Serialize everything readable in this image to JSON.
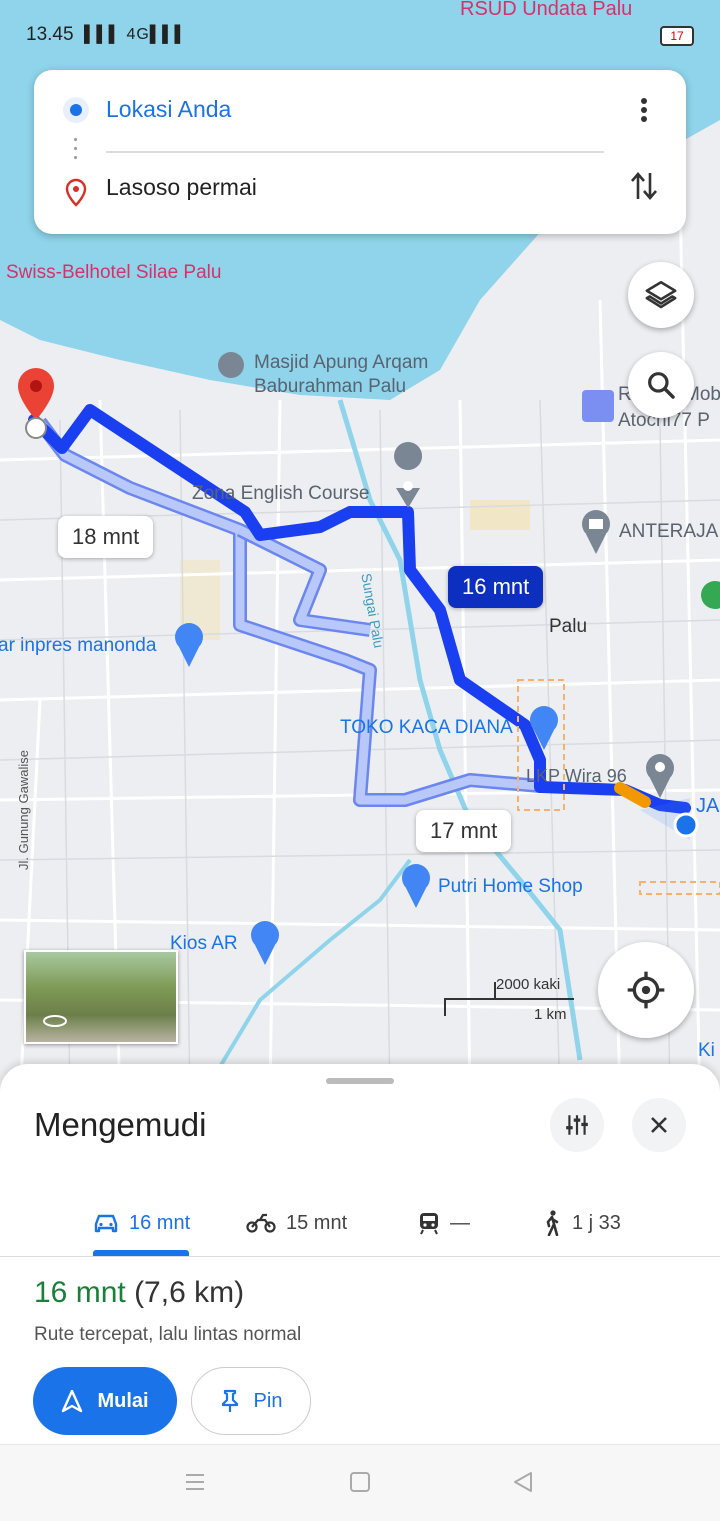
{
  "status_bar": {
    "time": "13.45",
    "signal": "▌▌▌ 4G▌▌▌",
    "battery": "17"
  },
  "directions": {
    "origin": "Lokasi Anda",
    "destination": "Lasoso permai"
  },
  "map_labels": {
    "hospital": "RSUD Undata Palu",
    "hotel": "Swiss-Belhotel Silae Palu",
    "mosque_line1": "Masjid Apung Arqam",
    "mosque_line2": "Baburahman Palu",
    "dealer_line1": "R",
    "dealer_line1b": "Mob",
    "dealer_line2": "Atocni77 P",
    "course": "Zona English Course",
    "courier": "ANTERAJA",
    "river": "Sungai Palu",
    "city": "Palu",
    "market": "ar inpres manonda",
    "glass_shop": "TOKO KACA DIANA",
    "lkp": "LKP Wira 96",
    "ja": "JA",
    "street": "Jl. Gunung Gawalise",
    "home_shop": "Putri Home Shop",
    "kios": "Kios AR",
    "ki": "Ki"
  },
  "route_bubbles": {
    "alt_left": "18 mnt",
    "main": "16 mnt",
    "alt_bottom": "17 mnt"
  },
  "scale": {
    "imperial": "2000 kaki",
    "metric": "1 km"
  },
  "sheet": {
    "title": "Mengemudi",
    "tabs": [
      {
        "icon": "car-icon",
        "label": "16 mnt"
      },
      {
        "icon": "motorcycle-icon",
        "label": "15 mnt"
      },
      {
        "icon": "transit-icon",
        "label": "—"
      },
      {
        "icon": "walk-icon",
        "label": "1 j 33"
      }
    ],
    "duration": "16 mnt",
    "distance": "(7,6 km)",
    "description": "Rute tercepat, lalu lintas normal",
    "start_label": "Mulai",
    "pin_label": "Pin"
  },
  "colors": {
    "accent": "#1a73e8",
    "route_main": "#1a3ff0",
    "route_alt": "#a9bdf7",
    "eta_green": "#188038",
    "water": "#8fd4ea",
    "land": "#e9ebee"
  }
}
